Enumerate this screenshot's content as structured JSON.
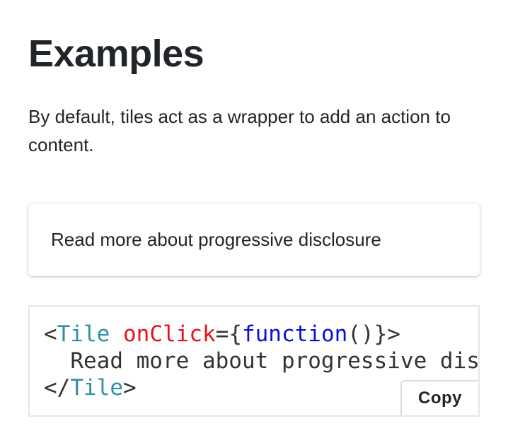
{
  "page": {
    "title": "Examples",
    "intro": "By default, tiles act as a wrapper to add an action to content."
  },
  "tile": {
    "label": "Read more about progressive disclosure"
  },
  "code_example": {
    "line1": {
      "open_bracket": "<",
      "tag": "Tile",
      "space": " ",
      "attr": "onClick",
      "equals_brace": "={",
      "keyword": "function",
      "rest": "()}>"
    },
    "line2": "  Read more about progressive disclosure",
    "line3": {
      "open_bracket": "</",
      "tag": "Tile",
      "close_bracket": ">"
    },
    "copy_label": "Copy"
  }
}
